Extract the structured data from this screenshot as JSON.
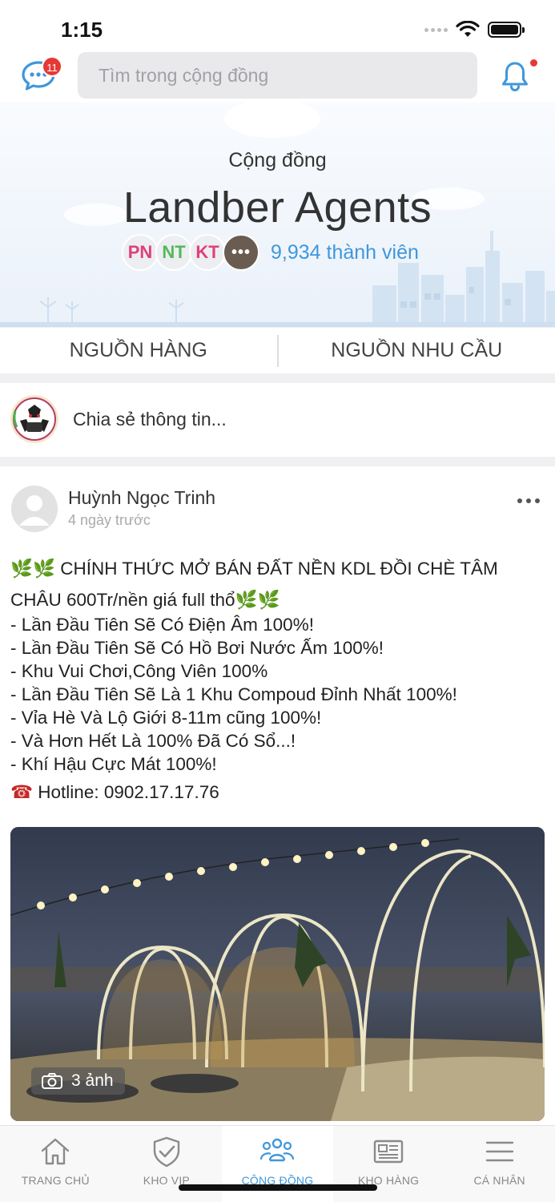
{
  "status_bar": {
    "time": "1:15"
  },
  "top_bar": {
    "chat_badge": "11",
    "search_placeholder": "Tìm trong cộng đồng"
  },
  "hero": {
    "subtitle": "Cộng đồng",
    "title": "Landber Agents",
    "member_initials": [
      "PN",
      "NT",
      "KT"
    ],
    "more_label": "•••",
    "member_count": "9,934 thành viên"
  },
  "tabs": [
    "NGUỒN HÀNG",
    "NGUỒN NHU CẦU"
  ],
  "share": {
    "prompt": "Chia sẻ thông tin..."
  },
  "post": {
    "author": "Huỳnh Ngọc Trinh",
    "time": "4 ngày trước",
    "headline": "CHÍNH THỨC MỞ BÁN ĐẤT NỀN KDL ĐỒI CHÈ TÂM",
    "headline2": "CHÂU 600Tr/nền giá full thổ",
    "lines": [
      "- Lần Đầu Tiên Sẽ Có Điện Âm 100%!",
      "- Lần Đầu Tiên Sẽ Có Hồ Bơi Nước Ấm 100%!",
      "- Khu Vui Chơi,Công Viên 100%",
      "- Lần Đầu Tiên Sẽ Là 1 Khu Compoud Đỉnh Nhất 100%!",
      "- Vỉa Hè Và Lộ Giới 8-11m cũng 100%!",
      "- Và Hơn Hết Là 100% Đã Có Sổ...!",
      "- Khí Hậu Cực Mát 100%!"
    ],
    "hotline": "Hotline: 0902.17.17.76",
    "photo_count": "3 ảnh"
  },
  "bottom_nav": [
    {
      "label": "TRANG CHỦ",
      "icon": "home-icon"
    },
    {
      "label": "KHO VIP",
      "icon": "shield-check-icon"
    },
    {
      "label": "CỘNG ĐỒNG",
      "icon": "community-icon",
      "active": true
    },
    {
      "label": "KHO HÀNG",
      "icon": "newspaper-icon"
    },
    {
      "label": "CÁ NHÂN",
      "icon": "menu-icon"
    }
  ],
  "colors": {
    "accent": "#3f97db",
    "badge": "#e53935",
    "search_bg": "#e9e9ec"
  }
}
